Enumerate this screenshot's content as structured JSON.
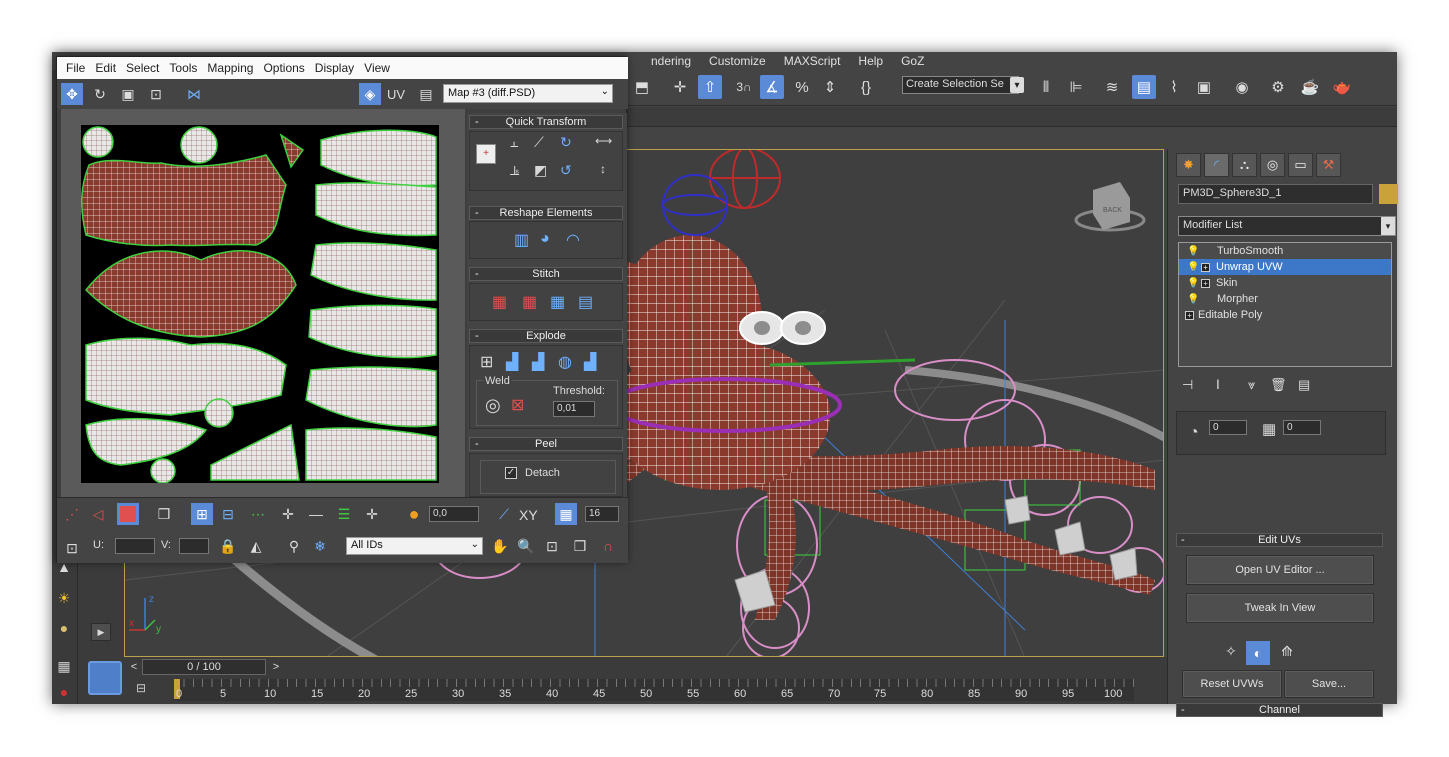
{
  "main_menu": [
    "ndering",
    "Customize",
    "MAXScript",
    "Help",
    "GoZ"
  ],
  "main_toolbar": {
    "selection_set_placeholder": "Create Selection Se",
    "icons": [
      "move-icon",
      "select-object-icon",
      "angle-snap-icon",
      "percent-snap-icon",
      "spinner-snap-icon",
      "edit-named-selection-icon",
      "mirror-icon",
      "align-icon",
      "layer-icon",
      "scene-explorer-icon",
      "curve-editor-icon",
      "schematic-icon",
      "material-editor-icon",
      "render-setup-icon",
      "render-frame-icon",
      "render-icon"
    ],
    "snap_label": "3"
  },
  "uv_editor": {
    "menu": [
      "File",
      "Edit",
      "Select",
      "Tools",
      "Mapping",
      "Options",
      "Display",
      "View"
    ],
    "uv_label": "UV",
    "map_select": "Map #3 (diff.PSD)",
    "panels": {
      "quick_transform": "Quick Transform",
      "reshape": "Reshape Elements",
      "stitch": "Stitch",
      "explode": "Explode",
      "weld": "Weld",
      "threshold_label": "Threshold:",
      "threshold_value": "0,01",
      "peel": "Peel",
      "detach": "Detach"
    },
    "bottom": {
      "soft_value": "0,0",
      "xy_label": "XY",
      "grid_value": "16",
      "u_label": "U:",
      "v_label": "V:",
      "id_select": "All IDs"
    }
  },
  "viewport": {
    "cube_label": "BACK",
    "axis_z": "z",
    "axis_x": "x",
    "axis_y": "y"
  },
  "timeline": {
    "frame": "0 / 100",
    "prev": "<",
    "next": ">",
    "ticks": [
      "0",
      "5",
      "10",
      "15",
      "20",
      "25",
      "30",
      "35",
      "40",
      "45",
      "50",
      "55",
      "60",
      "65",
      "70",
      "75",
      "80",
      "85",
      "90",
      "95",
      "100"
    ]
  },
  "command_panel": {
    "object_name": "PM3D_Sphere3D_1",
    "modifier_list": "Modifier List",
    "stack": [
      {
        "label": "TurboSmooth",
        "selected": false,
        "expand": false,
        "indent": true
      },
      {
        "label": "Unwrap UVW",
        "selected": true,
        "expand": true,
        "indent": true
      },
      {
        "label": "Skin",
        "selected": false,
        "expand": true,
        "indent": true
      },
      {
        "label": "Morpher",
        "selected": false,
        "expand": false,
        "indent": true
      },
      {
        "label": "Editable Poly",
        "selected": false,
        "expand": true,
        "indent": false
      }
    ],
    "spinner_a": "0",
    "spinner_b": "0",
    "edit_uvs": "Edit UVs",
    "open_uv_editor": "Open UV Editor ...",
    "tweak_in_view": "Tweak In View",
    "channel": "Channel",
    "reset_uvws": "Reset UVWs",
    "save": "Save..."
  },
  "colors": {
    "accent": "#5b8ad6",
    "selected_row": "#3d78c8",
    "viewport_border": "#bba14a",
    "object_color": "#c9a33a",
    "uv_mesh_fill": "#8a3a2c"
  }
}
